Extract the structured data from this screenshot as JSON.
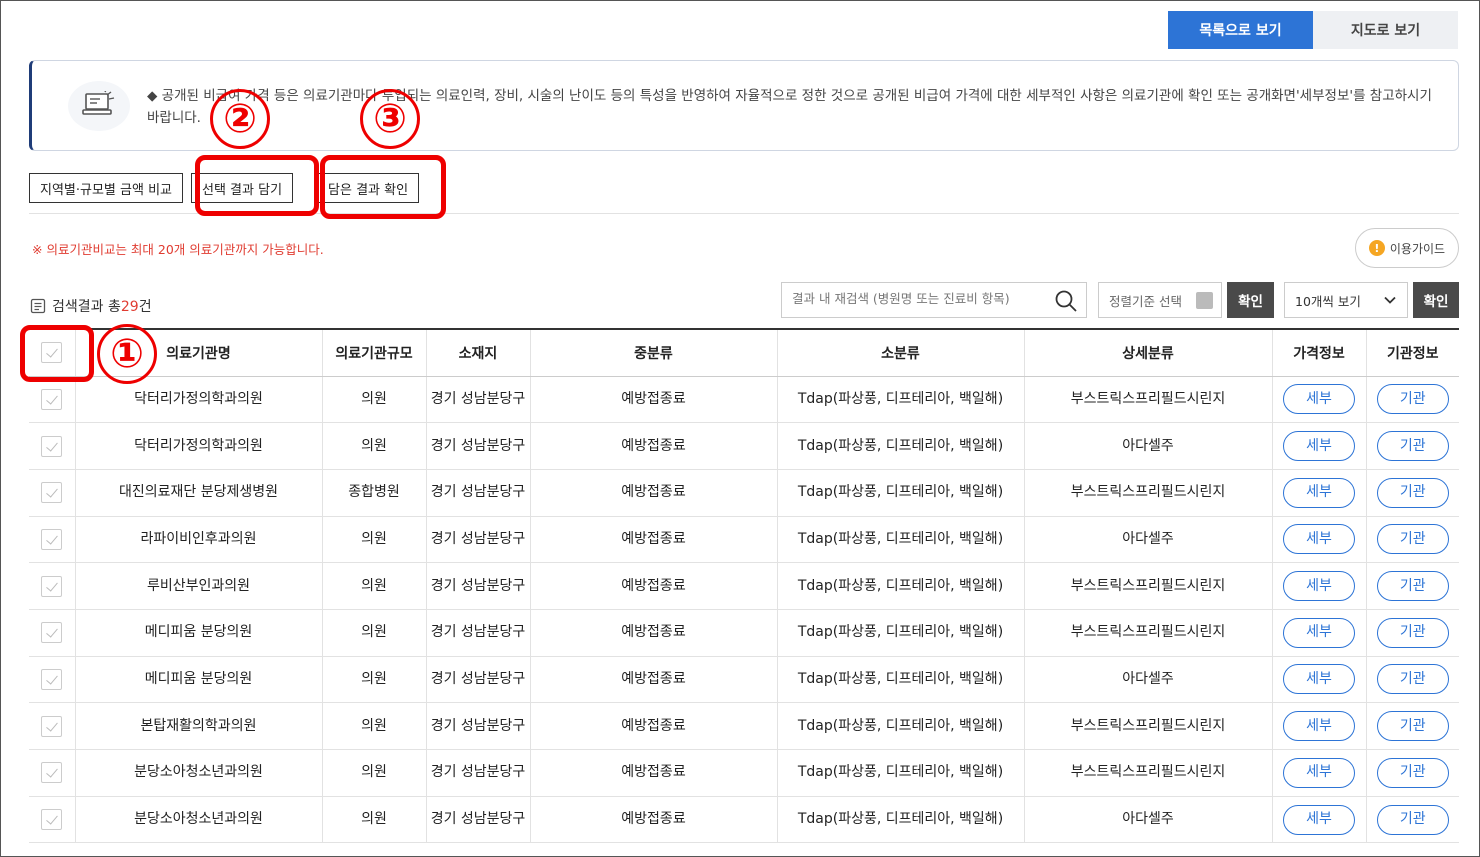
{
  "view_toggle": {
    "list_label": "목록으로 보기",
    "map_label": "지도로 보기"
  },
  "notice": {
    "text": "◆ 공개된 비급여 가격 등은 의료기관마다 투입되는 의료인력, 장비, 시술의 난이도 등의 특성을 반영하여 자율적으로 정한 것으로 공개된 비급여 가격에 대한 세부적인 사항은 의료기관에 확인 또는 공개화면'세부정보'를 참고하시기 바랍니다."
  },
  "actions": {
    "compare_label": "지역별·규모별 금액 비교",
    "add_label": "선택 결과 담기",
    "check_label": "담은 결과 확인"
  },
  "warning_text": "※ 의료기관비교는 최대 20개 의료기관까지 가능합니다.",
  "guide_label": "이용가이드",
  "result_count": {
    "prefix": "검색결과 총",
    "count": "29",
    "suffix": "건"
  },
  "search": {
    "placeholder": "결과 내 재검색 (병원명 또는 진료비 항목)"
  },
  "sort": {
    "label": "정렬기준 선택",
    "confirm_label": "확인"
  },
  "per_page": {
    "label": "10개씩 보기",
    "confirm_label": "확인"
  },
  "table": {
    "headers": [
      "의료기관명",
      "의료기관규모",
      "소재지",
      "중분류",
      "소분류",
      "상세분류",
      "가격정보",
      "기관정보"
    ],
    "detail_btn": "세부",
    "org_btn": "기관",
    "rows": [
      {
        "name": "닥터리가정의학과의원",
        "scale": "의원",
        "location": "경기 성남분당구",
        "mid": "예방접종료",
        "small": "Tdap(파상풍, 디프테리아, 백일해)",
        "detail": "부스트릭스프리필드시린지"
      },
      {
        "name": "닥터리가정의학과의원",
        "scale": "의원",
        "location": "경기 성남분당구",
        "mid": "예방접종료",
        "small": "Tdap(파상풍, 디프테리아, 백일해)",
        "detail": "아다셀주"
      },
      {
        "name": "대진의료재단 분당제생병원",
        "scale": "종합병원",
        "location": "경기 성남분당구",
        "mid": "예방접종료",
        "small": "Tdap(파상풍, 디프테리아, 백일해)",
        "detail": "부스트릭스프리필드시린지"
      },
      {
        "name": "라파이비인후과의원",
        "scale": "의원",
        "location": "경기 성남분당구",
        "mid": "예방접종료",
        "small": "Tdap(파상풍, 디프테리아, 백일해)",
        "detail": "아다셀주"
      },
      {
        "name": "루비산부인과의원",
        "scale": "의원",
        "location": "경기 성남분당구",
        "mid": "예방접종료",
        "small": "Tdap(파상풍, 디프테리아, 백일해)",
        "detail": "부스트릭스프리필드시린지"
      },
      {
        "name": "메디피움 분당의원",
        "scale": "의원",
        "location": "경기 성남분당구",
        "mid": "예방접종료",
        "small": "Tdap(파상풍, 디프테리아, 백일해)",
        "detail": "부스트릭스프리필드시린지"
      },
      {
        "name": "메디피움 분당의원",
        "scale": "의원",
        "location": "경기 성남분당구",
        "mid": "예방접종료",
        "small": "Tdap(파상풍, 디프테리아, 백일해)",
        "detail": "아다셀주"
      },
      {
        "name": "본탑재활의학과의원",
        "scale": "의원",
        "location": "경기 성남분당구",
        "mid": "예방접종료",
        "small": "Tdap(파상풍, 디프테리아, 백일해)",
        "detail": "부스트릭스프리필드시린지"
      },
      {
        "name": "분당소아청소년과의원",
        "scale": "의원",
        "location": "경기 성남분당구",
        "mid": "예방접종료",
        "small": "Tdap(파상풍, 디프테리아, 백일해)",
        "detail": "부스트릭스프리필드시린지"
      },
      {
        "name": "분당소아청소년과의원",
        "scale": "의원",
        "location": "경기 성남분당구",
        "mid": "예방접종료",
        "small": "Tdap(파상풍, 디프테리아, 백일해)",
        "detail": "아다셀주"
      }
    ]
  },
  "annotations": {
    "one": "①",
    "two": "②",
    "three": "③"
  },
  "colors": {
    "primary": "#2d74d6",
    "warning": "#e03c31",
    "annotation": "#ee0000"
  }
}
